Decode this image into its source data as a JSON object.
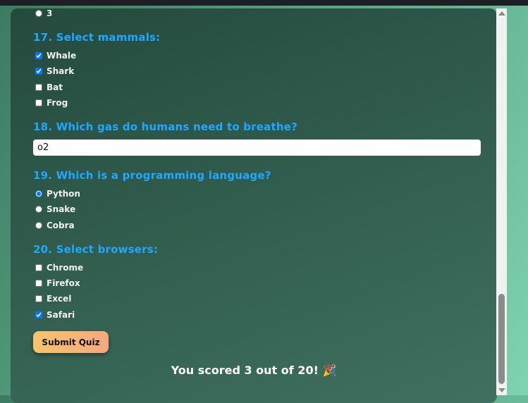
{
  "quiz": {
    "q16_tail": {
      "option": "3"
    },
    "q17": {
      "title": "17. Select mammals:",
      "options": [
        {
          "label": "Whale",
          "checked": true
        },
        {
          "label": "Shark",
          "checked": true
        },
        {
          "label": "Bat",
          "checked": false
        },
        {
          "label": "Frog",
          "checked": false
        }
      ]
    },
    "q18": {
      "title": "18. Which gas do humans need to breathe?",
      "value": "o2"
    },
    "q19": {
      "title": "19. Which is a programming language?",
      "options": [
        {
          "label": "Python",
          "selected": true
        },
        {
          "label": "Snake",
          "selected": false
        },
        {
          "label": "Cobra",
          "selected": false
        }
      ]
    },
    "q20": {
      "title": "20. Select browsers:",
      "options": [
        {
          "label": "Chrome",
          "checked": false
        },
        {
          "label": "Firefox",
          "checked": false
        },
        {
          "label": "Excel",
          "checked": false
        },
        {
          "label": "Safari",
          "checked": true
        }
      ]
    },
    "submit_label": "Submit Quiz",
    "result_text": "You scored 3 out of 20! 🎉"
  },
  "colors": {
    "question": "#1fa8ff",
    "option_text": "#f2f2f2",
    "button_gradient": [
      "#f7c46c",
      "#f5a880"
    ]
  }
}
